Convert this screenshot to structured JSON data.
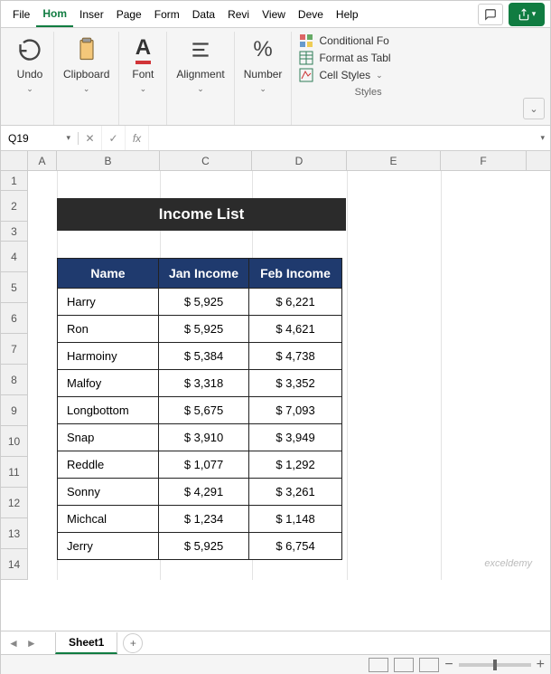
{
  "menu": {
    "tabs": [
      "File",
      "Hom",
      "Inser",
      "Page",
      "Form",
      "Data",
      "Revi",
      "View",
      "Deve",
      "Help"
    ],
    "active_index": 1
  },
  "ribbon": {
    "undo": "Undo",
    "clipboard": "Clipboard",
    "font": "Font",
    "alignment": "Alignment",
    "number": "Number",
    "conditional": "Conditional Fo",
    "format_table": "Format as Tabl",
    "cell_styles": "Cell Styles",
    "styles_label": "Styles"
  },
  "formula_bar": {
    "name_box": "Q19",
    "value": ""
  },
  "columns": [
    "A",
    "B",
    "C",
    "D",
    "E",
    "F"
  ],
  "rows": [
    "1",
    "2",
    "3",
    "4",
    "5",
    "6",
    "7",
    "8",
    "9",
    "10",
    "11",
    "12",
    "13",
    "14"
  ],
  "title": "Income List",
  "table": {
    "headers": [
      "Name",
      "Jan Income",
      "Feb Income"
    ],
    "rows": [
      {
        "name": "Harry",
        "jan": "$ 5,925",
        "feb": "$ 6,221"
      },
      {
        "name": "Ron",
        "jan": "$ 5,925",
        "feb": "$ 4,621"
      },
      {
        "name": "Harmoiny",
        "jan": "$ 5,384",
        "feb": "$ 4,738"
      },
      {
        "name": "Malfoy",
        "jan": "$ 3,318",
        "feb": "$ 3,352"
      },
      {
        "name": "Longbottom",
        "jan": "$ 5,675",
        "feb": "$ 7,093"
      },
      {
        "name": "Snap",
        "jan": "$ 3,910",
        "feb": "$ 3,949"
      },
      {
        "name": "Reddle",
        "jan": "$ 1,077",
        "feb": "$ 1,292"
      },
      {
        "name": "Sonny",
        "jan": "$ 4,291",
        "feb": "$ 3,261"
      },
      {
        "name": "Michcal",
        "jan": "$ 1,234",
        "feb": "$ 1,148"
      },
      {
        "name": "Jerry",
        "jan": "$ 5,925",
        "feb": "$ 6,754"
      }
    ]
  },
  "watermark": "exceldemy",
  "sheet": {
    "name": "Sheet1"
  }
}
